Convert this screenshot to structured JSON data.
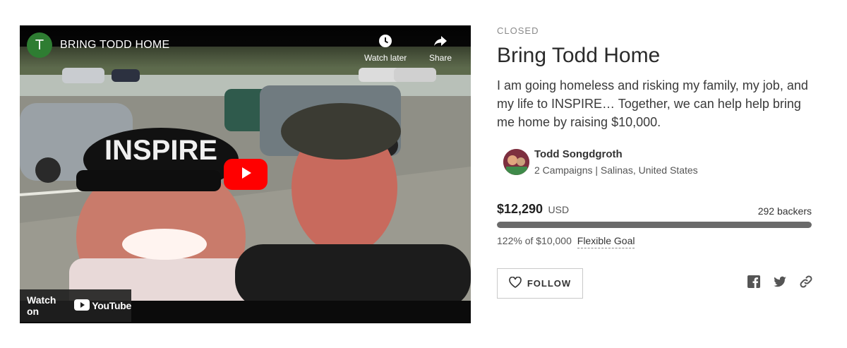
{
  "video": {
    "channel_initial": "T",
    "title": "BRING TODD HOME",
    "watch_later_label": "Watch later",
    "share_label": "Share",
    "watch_on_label": "Watch on",
    "youtube_label": "YouTube",
    "cap_text": "INSPIRE"
  },
  "campaign": {
    "status": "CLOSED",
    "title": "Bring Todd Home",
    "blurb": "I am going homeless and risking my family, my job, and my life to INSPIRE… Together, we can help help bring me home by raising $10,000.",
    "owner_name": "Todd Songdgroth",
    "owner_meta": "2 Campaigns | Salinas, United States",
    "amount": "$12,290",
    "currency": "USD",
    "backers_count": "292",
    "backers_label": "backers",
    "progress_percent": 122,
    "goal_text": "122% of $10,000",
    "goal_type": "Flexible Goal",
    "follow_label": "FOLLOW"
  },
  "icons": {
    "watch_later": "clock-icon",
    "share": "share-arrow-icon",
    "play": "play-icon",
    "heart": "heart-icon",
    "facebook": "facebook-icon",
    "twitter": "twitter-icon",
    "link": "link-icon"
  },
  "colors": {
    "youtube_red": "#ff0000",
    "progress_fill": "#6a6a6a",
    "channel_avatar": "#2e7d32"
  }
}
